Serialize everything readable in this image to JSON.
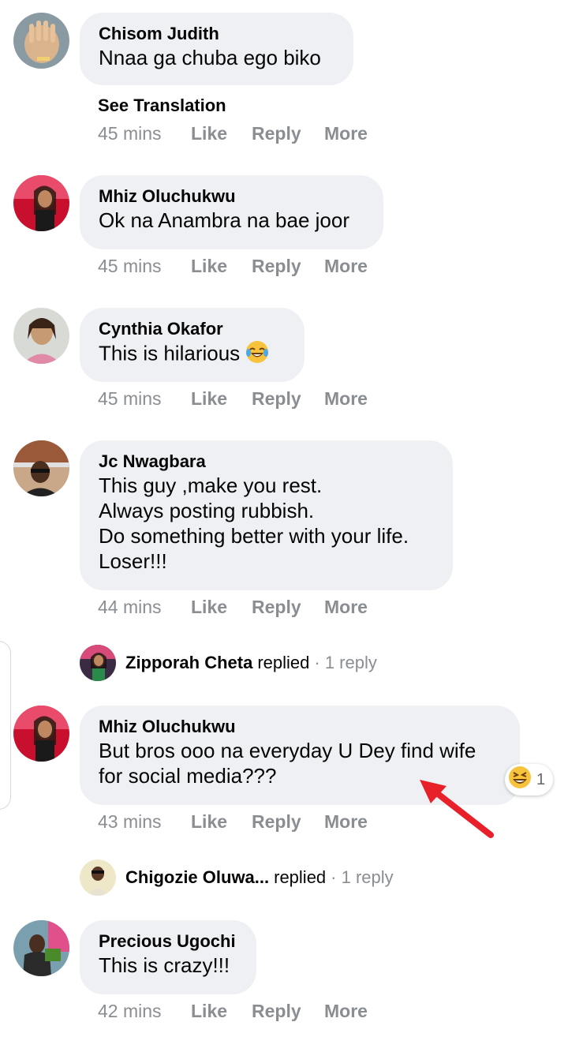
{
  "action_labels": {
    "like": "Like",
    "reply": "Reply",
    "more": "More"
  },
  "see_translation": "See Translation",
  "comments": [
    {
      "author": "Chisom Judith",
      "text": "Nnaa ga chuba ego biko",
      "time": "45 mins"
    },
    {
      "author": "Mhiz Oluchukwu",
      "text": "Ok na Anambra na bae joor",
      "time": "45 mins"
    },
    {
      "author": "Cynthia Okafor",
      "text": "This is hilarious",
      "emoji": "tears-of-joy-emoji",
      "time": "45 mins"
    },
    {
      "author": "Jc Nwagbara",
      "text": "This guy ,make you rest.\nAlways posting rubbish.\nDo something better with your life.\nLoser!!!",
      "time": "44 mins"
    },
    {
      "author": "Mhiz Oluchukwu",
      "text": "But bros ooo na everyday U Dey find wife\nfor social media???",
      "time": "43 mins",
      "reaction": {
        "icon": "laughing-emoji",
        "count": "1"
      }
    },
    {
      "author": "Precious Ugochi",
      "text": "This is crazy!!!",
      "time": "42 mins"
    }
  ],
  "replies": [
    {
      "name": "Zipporah Cheta",
      "verb": "replied",
      "count": "· 1 reply"
    },
    {
      "name": "Chigozie Oluwa...",
      "verb": "replied",
      "count": "· 1 reply"
    }
  ],
  "colors": {
    "bubble": "#eef0f3",
    "meta": "#8a8d91",
    "arrow": "#e8202a"
  }
}
